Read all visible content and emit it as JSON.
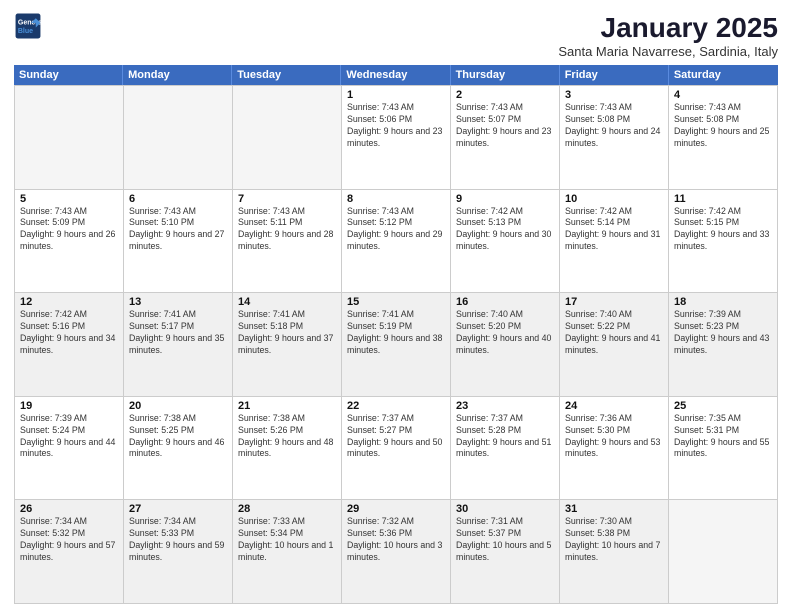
{
  "header": {
    "logo_line1": "General",
    "logo_line2": "Blue",
    "month": "January 2025",
    "location": "Santa Maria Navarrese, Sardinia, Italy"
  },
  "weekdays": [
    "Sunday",
    "Monday",
    "Tuesday",
    "Wednesday",
    "Thursday",
    "Friday",
    "Saturday"
  ],
  "weeks": [
    [
      {
        "day": "",
        "text": "",
        "empty": true
      },
      {
        "day": "",
        "text": "",
        "empty": true
      },
      {
        "day": "",
        "text": "",
        "empty": true
      },
      {
        "day": "1",
        "text": "Sunrise: 7:43 AM\nSunset: 5:06 PM\nDaylight: 9 hours and 23 minutes."
      },
      {
        "day": "2",
        "text": "Sunrise: 7:43 AM\nSunset: 5:07 PM\nDaylight: 9 hours and 23 minutes."
      },
      {
        "day": "3",
        "text": "Sunrise: 7:43 AM\nSunset: 5:08 PM\nDaylight: 9 hours and 24 minutes."
      },
      {
        "day": "4",
        "text": "Sunrise: 7:43 AM\nSunset: 5:08 PM\nDaylight: 9 hours and 25 minutes."
      }
    ],
    [
      {
        "day": "5",
        "text": "Sunrise: 7:43 AM\nSunset: 5:09 PM\nDaylight: 9 hours and 26 minutes."
      },
      {
        "day": "6",
        "text": "Sunrise: 7:43 AM\nSunset: 5:10 PM\nDaylight: 9 hours and 27 minutes."
      },
      {
        "day": "7",
        "text": "Sunrise: 7:43 AM\nSunset: 5:11 PM\nDaylight: 9 hours and 28 minutes."
      },
      {
        "day": "8",
        "text": "Sunrise: 7:43 AM\nSunset: 5:12 PM\nDaylight: 9 hours and 29 minutes."
      },
      {
        "day": "9",
        "text": "Sunrise: 7:42 AM\nSunset: 5:13 PM\nDaylight: 9 hours and 30 minutes."
      },
      {
        "day": "10",
        "text": "Sunrise: 7:42 AM\nSunset: 5:14 PM\nDaylight: 9 hours and 31 minutes."
      },
      {
        "day": "11",
        "text": "Sunrise: 7:42 AM\nSunset: 5:15 PM\nDaylight: 9 hours and 33 minutes."
      }
    ],
    [
      {
        "day": "12",
        "text": "Sunrise: 7:42 AM\nSunset: 5:16 PM\nDaylight: 9 hours and 34 minutes.",
        "shaded": true
      },
      {
        "day": "13",
        "text": "Sunrise: 7:41 AM\nSunset: 5:17 PM\nDaylight: 9 hours and 35 minutes.",
        "shaded": true
      },
      {
        "day": "14",
        "text": "Sunrise: 7:41 AM\nSunset: 5:18 PM\nDaylight: 9 hours and 37 minutes.",
        "shaded": true
      },
      {
        "day": "15",
        "text": "Sunrise: 7:41 AM\nSunset: 5:19 PM\nDaylight: 9 hours and 38 minutes.",
        "shaded": true
      },
      {
        "day": "16",
        "text": "Sunrise: 7:40 AM\nSunset: 5:20 PM\nDaylight: 9 hours and 40 minutes.",
        "shaded": true
      },
      {
        "day": "17",
        "text": "Sunrise: 7:40 AM\nSunset: 5:22 PM\nDaylight: 9 hours and 41 minutes.",
        "shaded": true
      },
      {
        "day": "18",
        "text": "Sunrise: 7:39 AM\nSunset: 5:23 PM\nDaylight: 9 hours and 43 minutes.",
        "shaded": true
      }
    ],
    [
      {
        "day": "19",
        "text": "Sunrise: 7:39 AM\nSunset: 5:24 PM\nDaylight: 9 hours and 44 minutes."
      },
      {
        "day": "20",
        "text": "Sunrise: 7:38 AM\nSunset: 5:25 PM\nDaylight: 9 hours and 46 minutes."
      },
      {
        "day": "21",
        "text": "Sunrise: 7:38 AM\nSunset: 5:26 PM\nDaylight: 9 hours and 48 minutes."
      },
      {
        "day": "22",
        "text": "Sunrise: 7:37 AM\nSunset: 5:27 PM\nDaylight: 9 hours and 50 minutes."
      },
      {
        "day": "23",
        "text": "Sunrise: 7:37 AM\nSunset: 5:28 PM\nDaylight: 9 hours and 51 minutes."
      },
      {
        "day": "24",
        "text": "Sunrise: 7:36 AM\nSunset: 5:30 PM\nDaylight: 9 hours and 53 minutes."
      },
      {
        "day": "25",
        "text": "Sunrise: 7:35 AM\nSunset: 5:31 PM\nDaylight: 9 hours and 55 minutes."
      }
    ],
    [
      {
        "day": "26",
        "text": "Sunrise: 7:34 AM\nSunset: 5:32 PM\nDaylight: 9 hours and 57 minutes.",
        "shaded": true
      },
      {
        "day": "27",
        "text": "Sunrise: 7:34 AM\nSunset: 5:33 PM\nDaylight: 9 hours and 59 minutes.",
        "shaded": true
      },
      {
        "day": "28",
        "text": "Sunrise: 7:33 AM\nSunset: 5:34 PM\nDaylight: 10 hours and 1 minute.",
        "shaded": true
      },
      {
        "day": "29",
        "text": "Sunrise: 7:32 AM\nSunset: 5:36 PM\nDaylight: 10 hours and 3 minutes.",
        "shaded": true
      },
      {
        "day": "30",
        "text": "Sunrise: 7:31 AM\nSunset: 5:37 PM\nDaylight: 10 hours and 5 minutes.",
        "shaded": true
      },
      {
        "day": "31",
        "text": "Sunrise: 7:30 AM\nSunset: 5:38 PM\nDaylight: 10 hours and 7 minutes.",
        "shaded": true
      },
      {
        "day": "",
        "text": "",
        "empty": true,
        "shaded": true
      }
    ]
  ]
}
